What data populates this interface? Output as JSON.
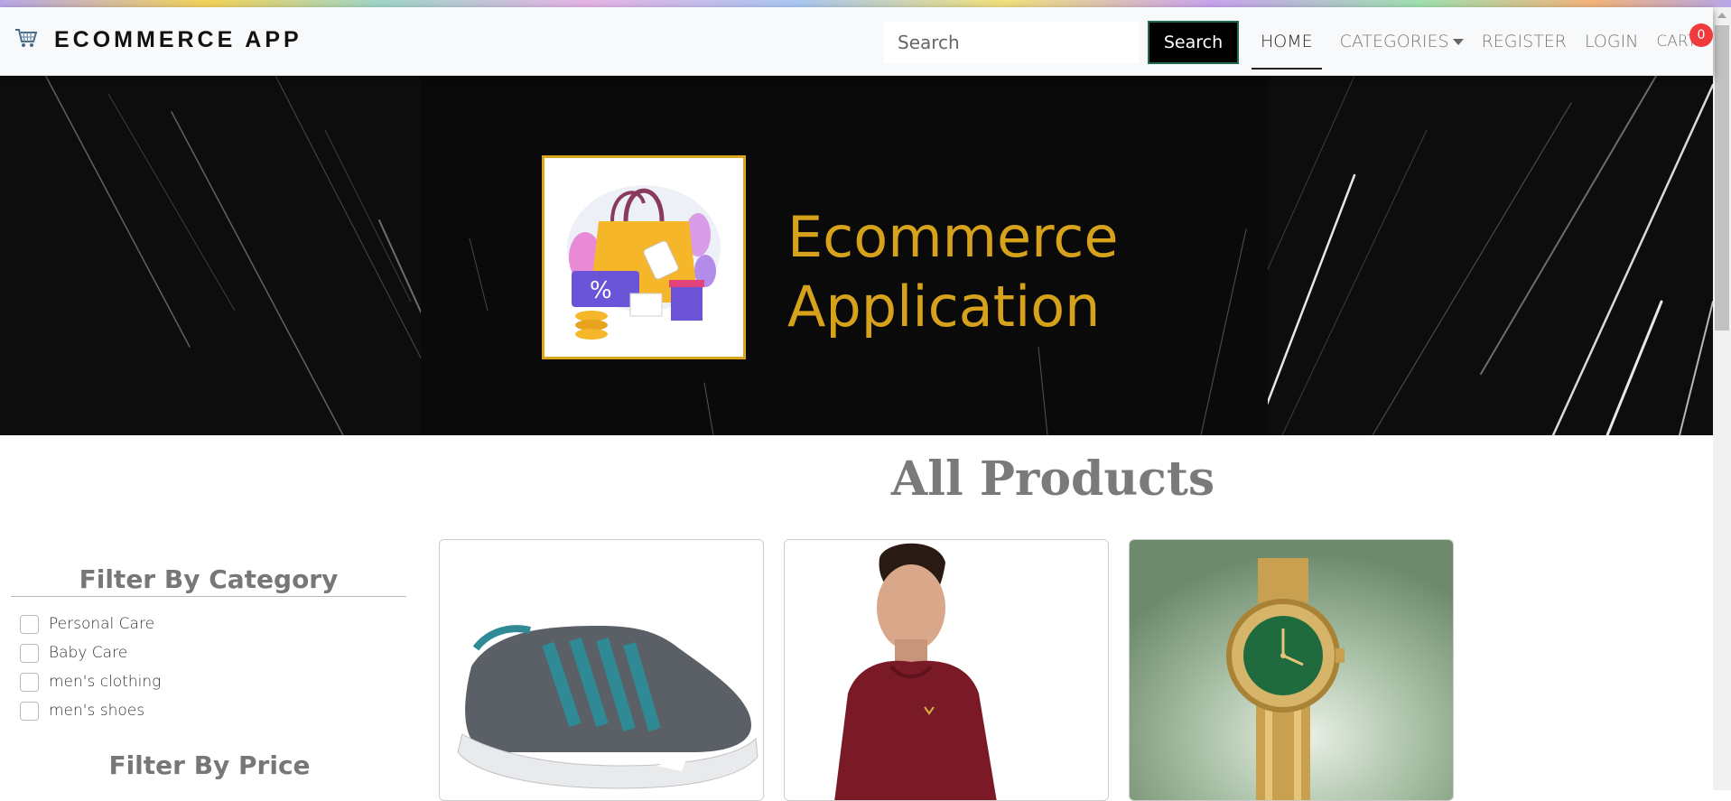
{
  "navbar": {
    "brand": "ECOMMERCE APP",
    "brand_icon": "shopping-cart-icon",
    "search": {
      "placeholder": "Search",
      "value": ""
    },
    "search_button": "Search",
    "links": {
      "home": "HOME",
      "categories": "CATEGORIES",
      "register": "REGISTER",
      "login": "LOGIN",
      "cart": "CART"
    },
    "cart_count": "0"
  },
  "banner": {
    "title_line1": "Ecommerce",
    "title_line2": "Application"
  },
  "main": {
    "title": "All Products"
  },
  "sidebar": {
    "category_heading": "Filter By Category",
    "categories": [
      "Personal Care",
      "Baby Care",
      "men's clothing",
      "men's shoes"
    ],
    "price_heading": "Filter By Price"
  },
  "products": [
    {
      "image": "sneaker-image"
    },
    {
      "image": "maroon-sweater-image"
    },
    {
      "image": "gold-watch-image"
    }
  ],
  "colors": {
    "accent": "#d7a21b",
    "badge": "#ef3b3b",
    "search_button": "#000000"
  }
}
